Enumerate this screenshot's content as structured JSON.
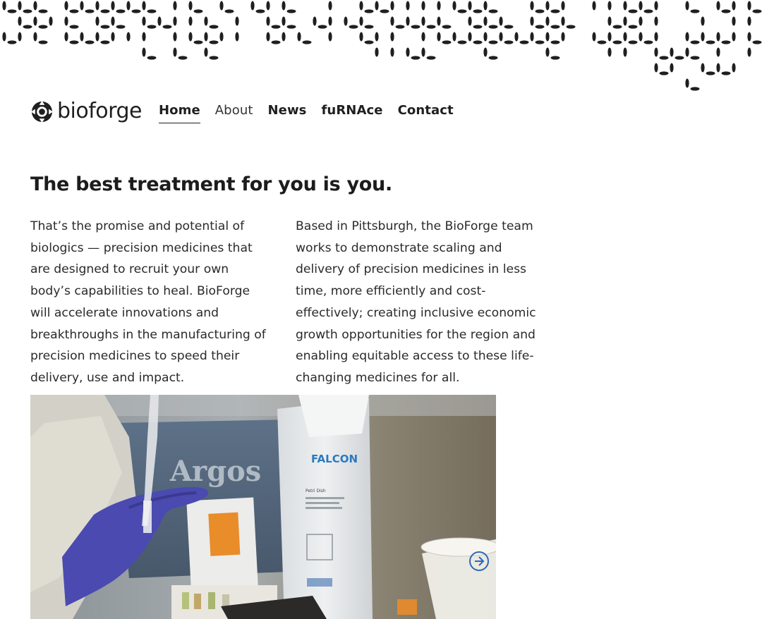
{
  "header": {
    "logo_text": "bioforge",
    "nav": [
      {
        "label": "Home",
        "active": true
      },
      {
        "label": "About",
        "active": false
      },
      {
        "label": "News",
        "active": false
      },
      {
        "label": "fuRNAce",
        "active": false
      },
      {
        "label": "Contact",
        "active": false
      }
    ]
  },
  "main": {
    "headline": "The best treatment for you is you.",
    "col_left_text": "That’s the promise and potential of biologics — precision medicines that are designed to recruit your own body’s capabilities to heal. BioForge will accelerate innovations and breakthroughs in the manufacturing of precision medicines to speed their delivery, use and impact.",
    "col_right_text": "Based in Pittsburgh, the BioForge team works to demonstrate scaling and delivery of precision medicines in less time, more efficiently and cost-effectively; creating inclusive economic growth opportunities for the region and enabling equitable access to these life-changing medicines for all.",
    "photo": {
      "box_brand": "Argos",
      "bag_brand": "FALCON",
      "bag_label": "Petri Dish"
    }
  },
  "colors": {
    "ink": "#1f1f1f",
    "background": "#ffffff",
    "glove": "#4a4ab0"
  }
}
